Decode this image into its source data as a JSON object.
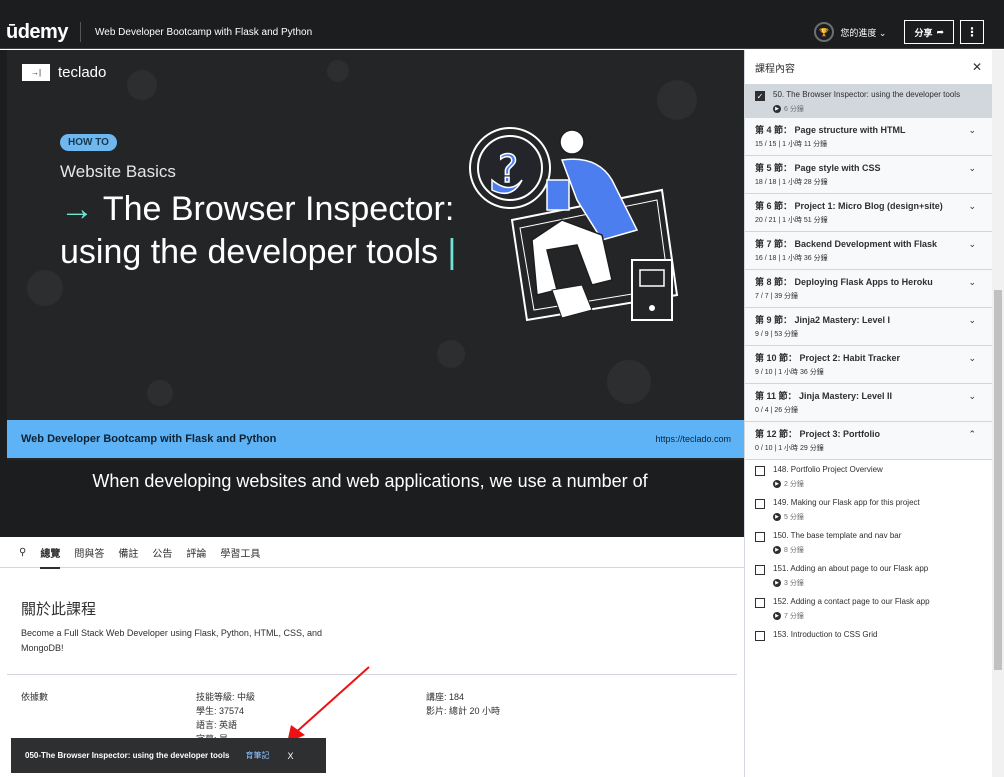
{
  "header": {
    "logo": "ūdemy",
    "course_title": "Web Developer Bootcamp with Flask and Python",
    "progress_label": "您的進度",
    "share_label": "分享",
    "more_label": "⋮"
  },
  "slide": {
    "brand": "teclado",
    "brand_mark": "→|",
    "badge": "HOW TO",
    "subtitle": "Website Basics",
    "title_arrow": "→",
    "title": "The Browser Inspector: using the developer tools",
    "cursor": "|",
    "bar_left": "Web Developer Bootcamp with Flask and Python",
    "bar_right": "https://teclado.com"
  },
  "caption": "When developing websites and web applications, we use a number of",
  "tabs": [
    "總覽",
    "問與答",
    "備註",
    "公告",
    "評論",
    "學習工具"
  ],
  "about": {
    "title": "關於此課程",
    "description": "Become a Full Stack Web Developer using Flask, Python, HTML, CSS, and MongoDB!",
    "stats_label": "依據數",
    "col1": [
      "技能等級: 中級",
      "學生: 37574",
      "語言: 英語",
      "字幕: 是"
    ],
    "col2": [
      "講座: 184",
      "影片: 總計 20 小時"
    ]
  },
  "toast": {
    "text": "050-The Browser Inspector: using the developer tools",
    "link": "育筆記",
    "close": "X"
  },
  "sidebar": {
    "title": "課程內容",
    "close": "✕",
    "current_lesson": {
      "title": "50. The Browser Inspector: using the developer tools",
      "duration": "6 分鐘"
    },
    "sections": [
      {
        "title": "第 4 節： Page structure with HTML",
        "meta": "15 / 15 | 1 小時 11 分鐘"
      },
      {
        "title": "第 5 節： Page style with CSS",
        "meta": "18 / 18 | 1 小時 28 分鐘"
      },
      {
        "title": "第 6 節： Project 1: Micro Blog (design+site)",
        "meta": "20 / 21 | 1 小時 51 分鐘"
      },
      {
        "title": "第 7 節： Backend Development with Flask",
        "meta": "16 / 18 | 1 小時 36 分鐘"
      },
      {
        "title": "第 8 節： Deploying Flask Apps to Heroku",
        "meta": "7 / 7 | 39 分鐘"
      },
      {
        "title": "第 9 節： Jinja2 Mastery: Level I",
        "meta": "9 / 9 | 53 分鐘"
      },
      {
        "title": "第 10 節： Project 2: Habit Tracker",
        "meta": "9 / 10 | 1 小時 36 分鐘"
      },
      {
        "title": "第 11 節： Jinja Mastery: Level II",
        "meta": "0 / 4 | 26 分鐘"
      },
      {
        "title": "第 12 節： Project 3: Portfolio",
        "meta": "0 / 10 | 1 小時 29 分鐘"
      }
    ],
    "lessons": [
      {
        "title": "148. Portfolio Project Overview",
        "duration": "2 分鐘"
      },
      {
        "title": "149. Making our Flask app for this project",
        "duration": "5 分鐘"
      },
      {
        "title": "150. The base template and nav bar",
        "duration": "8 分鐘"
      },
      {
        "title": "151. Adding an about page to our Flask app",
        "duration": "3 分鐘"
      },
      {
        "title": "152. Adding a contact page to our Flask app",
        "duration": "7 分鐘"
      },
      {
        "title": "153. Introduction to CSS Grid",
        "duration": ""
      }
    ]
  },
  "colors": {
    "dark": "#1c1d1f",
    "blue_bar": "#5db3f5",
    "accent": "#6fe3d6",
    "badge": "#6fb7ef"
  }
}
